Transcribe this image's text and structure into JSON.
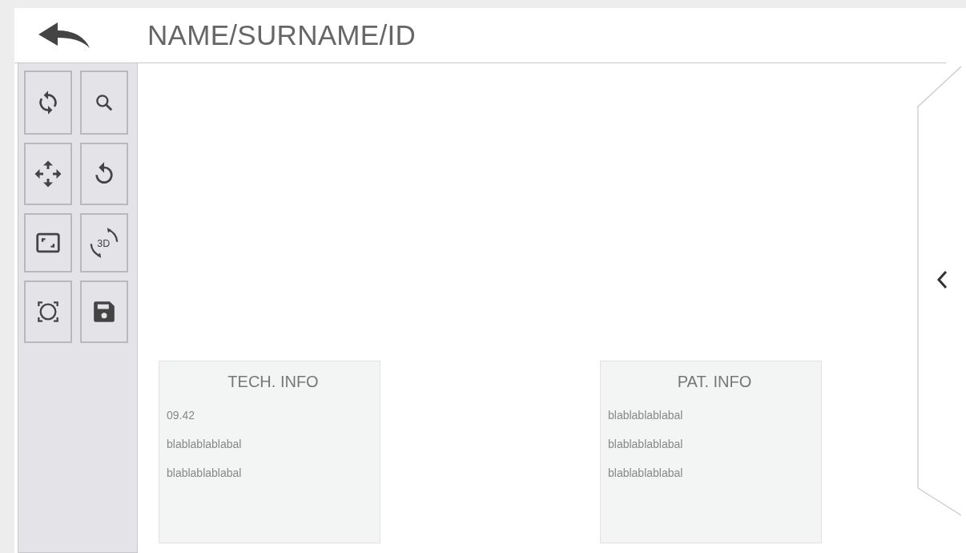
{
  "header": {
    "title": "NAME/SURNAME/ID"
  },
  "tools": [
    {
      "kind": "sync"
    },
    {
      "kind": "search"
    },
    {
      "kind": "move"
    },
    {
      "kind": "reset"
    },
    {
      "kind": "fit"
    },
    {
      "kind": "rotate3d",
      "label": "3D"
    },
    {
      "kind": "focus"
    },
    {
      "kind": "save"
    }
  ],
  "cards": [
    {
      "title": "TECH. INFO",
      "lines": [
        "09.42",
        "blablablablabal",
        "blablablablabal"
      ]
    },
    {
      "title": "PAT. INFO",
      "lines": [
        "blablablablabal",
        "blablablablabal",
        "blablablablabal"
      ]
    }
  ]
}
